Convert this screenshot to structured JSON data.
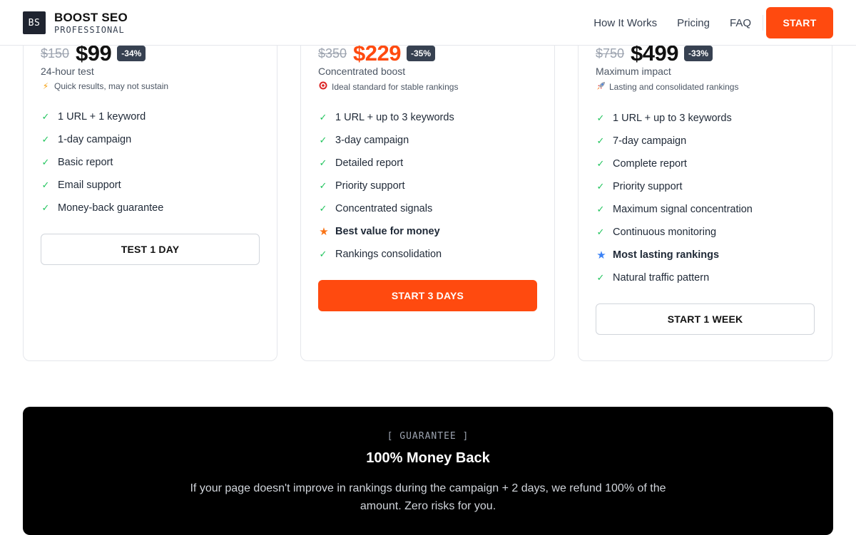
{
  "brand": {
    "mark": "BS",
    "title": "BOOST SEO",
    "subtitle": "PROFESSIONAL"
  },
  "nav": {
    "links": [
      "How It Works",
      "Pricing",
      "FAQ"
    ],
    "cta": "START",
    "accent": "#ff4a0f"
  },
  "plans": [
    {
      "old_price": "$150",
      "price": "$99",
      "discount": "-34%",
      "subtitle": "24-hour test",
      "note_icon": "lightning-icon",
      "note_glyph": "⚡",
      "note": "Quick results, may not sustain",
      "features": [
        "1 URL + 1 keyword",
        "1-day campaign",
        "Basic report",
        "Email support",
        "Money-back guarantee"
      ],
      "button": "TEST 1 DAY"
    },
    {
      "old_price": "$350",
      "price": "$229",
      "discount": "-35%",
      "subtitle": "Concentrated boost",
      "note_icon": "target-icon",
      "note_glyph": "🎯",
      "note": "Ideal standard for stable rankings",
      "features": [
        "1 URL + up to 3 keywords",
        "3-day campaign",
        "Detailed report",
        "Priority support",
        "Concentrated signals",
        "Best value for money",
        "Rankings consolidation"
      ],
      "highlight_index": 5,
      "button": "START 3 DAYS"
    },
    {
      "old_price": "$750",
      "price": "$499",
      "discount": "-33%",
      "subtitle": "Maximum impact",
      "note_icon": "rocket-icon",
      "note_glyph": "🚀",
      "note": "Lasting and consolidated rankings",
      "features": [
        "1 URL + up to 3 keywords",
        "7-day campaign",
        "Complete report",
        "Priority support",
        "Maximum signal concentration",
        "Continuous monitoring",
        "Most lasting rankings",
        "Natural traffic pattern"
      ],
      "highlight_index": 6,
      "button": "START 1 WEEK"
    }
  ],
  "guarantee": {
    "tag": "[ GUARANTEE ]",
    "title": "100% Money Back",
    "text": "If your page doesn't improve in rankings during the campaign + 2 days, we refund 100% of the amount. Zero risks for you."
  }
}
